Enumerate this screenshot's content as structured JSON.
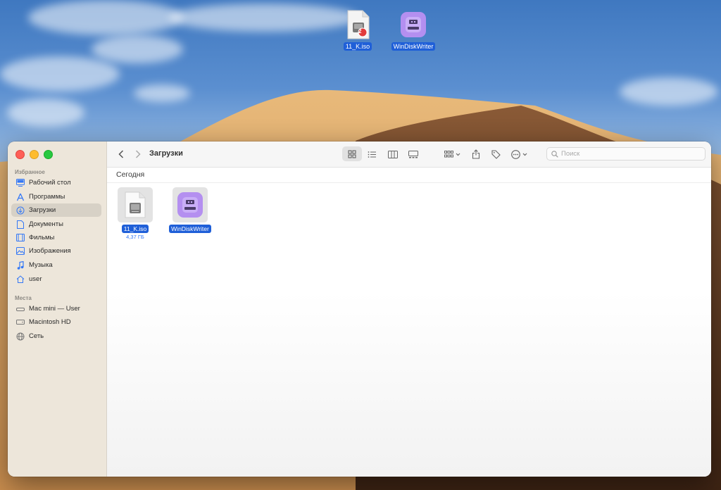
{
  "desktop": {
    "icons": [
      {
        "label": "11_K.iso",
        "icon": "iso-file-icon",
        "badge": "2"
      },
      {
        "label": "WinDiskWriter",
        "icon": "windiskwriter-app-icon"
      }
    ]
  },
  "finder": {
    "title": "Загрузки",
    "search_placeholder": "Поиск",
    "group_title": "Сегодня",
    "sidebar": {
      "favorites_header": "Избранное",
      "favorites": [
        {
          "label": "Рабочий стол",
          "icon": "desktop-icon"
        },
        {
          "label": "Программы",
          "icon": "applications-icon"
        },
        {
          "label": "Загрузки",
          "icon": "downloads-icon",
          "selected": true
        },
        {
          "label": "Документы",
          "icon": "documents-icon"
        },
        {
          "label": "Фильмы",
          "icon": "movies-icon"
        },
        {
          "label": "Изображения",
          "icon": "pictures-icon"
        },
        {
          "label": "Музыка",
          "icon": "music-icon"
        },
        {
          "label": "user",
          "icon": "home-icon"
        }
      ],
      "locations_header": "Места",
      "locations": [
        {
          "label": "Mac mini — User",
          "icon": "computer-icon"
        },
        {
          "label": "Macintosh HD",
          "icon": "disk-icon"
        },
        {
          "label": "Сеть",
          "icon": "network-icon"
        }
      ]
    },
    "files": [
      {
        "name": "11_K.iso",
        "size": "4,37 ГБ",
        "icon": "iso-file-icon"
      },
      {
        "name": "WinDiskWriter",
        "icon": "windiskwriter-app-icon"
      }
    ]
  },
  "colors": {
    "selection_blue": "#1f5fd8",
    "accent": "#3478f6",
    "app_icon_purple": "#a882ea"
  }
}
